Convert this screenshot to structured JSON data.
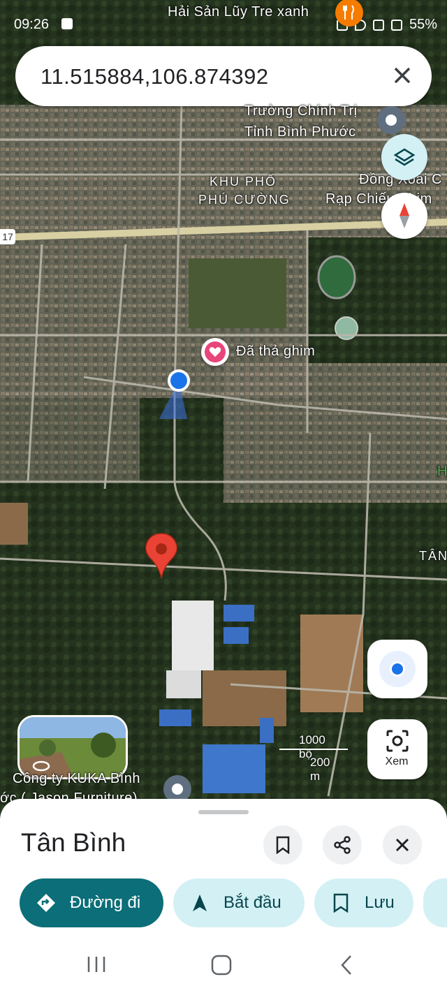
{
  "status_bar": {
    "time": "09:26",
    "battery": "55%"
  },
  "search": {
    "query": "11.515884,106.874392"
  },
  "map": {
    "labels": {
      "restaurant": "Hải Sản Lũy Tre xanh",
      "school_line1": "Trường Chính Trị",
      "school_line2": "Tỉnh Bình Phước",
      "district_line1": "KHU PHỐ",
      "district_line2": "PHÚ CƯỜNG",
      "cinema_line1": "Đồng Xoài C",
      "cinema_line2": "Rạp Chiếu Phim",
      "road_number": "17",
      "dropped_pin": "Đã thả ghim",
      "tan": "TÂN",
      "company_line1": "Công ty KUKA Bình",
      "company_line2": "ớc ( Jason Furniture)",
      "edge_letter": "H"
    },
    "scale": {
      "imperial": "1000 bộ",
      "metric": "200 m"
    }
  },
  "lens": {
    "label": "Xem"
  },
  "place": {
    "title": "Tân Bình",
    "actions": {
      "directions": "Đường đi",
      "start": "Bắt đầu",
      "save": "Lưu"
    }
  },
  "colors": {
    "primary_chip": "#0b6e78",
    "secondary_chip": "#d3f0f5",
    "pin_red": "#ea4335",
    "location_blue": "#1a73e8",
    "saved_pin_pink": "#e8457a"
  }
}
